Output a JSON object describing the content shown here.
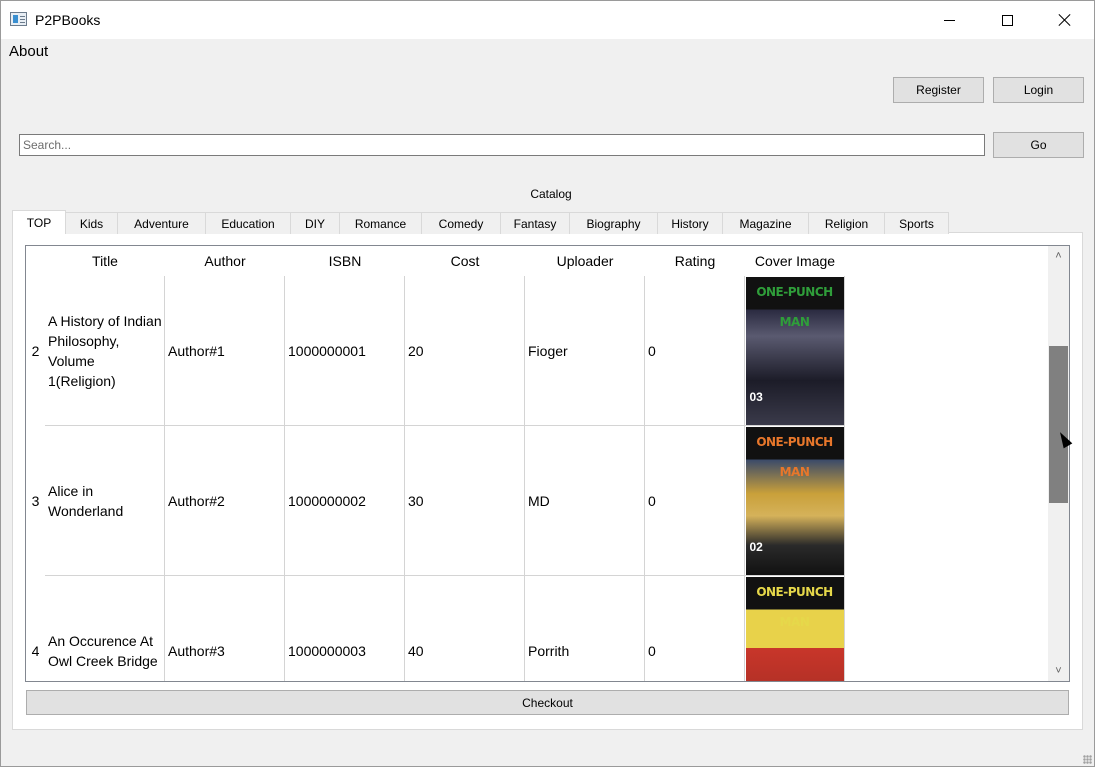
{
  "window": {
    "title": "P2PBooks",
    "icon": "app-window-icon"
  },
  "menu": {
    "about": "About"
  },
  "auth": {
    "register": "Register",
    "login": "Login"
  },
  "search": {
    "placeholder": "Search...",
    "value": "",
    "go": "Go"
  },
  "catalog": {
    "label": "Catalog",
    "tabs": [
      "TOP",
      "Kids",
      "Adventure",
      "Education",
      "DIY",
      "Romance",
      "Comedy",
      "Fantasy",
      "Biography",
      "History",
      "Magazine",
      "Religion",
      "Sports"
    ],
    "active_tab": "TOP"
  },
  "table": {
    "columns": [
      "Title",
      "Author",
      "ISBN",
      "Cost",
      "Uploader",
      "Rating",
      "Cover Image"
    ],
    "rows": [
      {
        "index": "2",
        "title": "A History of Indian Philosophy, Volume 1(Religion)",
        "author": "Author#1",
        "isbn": "1000000001",
        "cost": "20",
        "uploader": "Fioger",
        "rating": "0",
        "cover": {
          "text": "ONE-PUNCH MAN",
          "volume": "03",
          "color": "#2f9e3a"
        }
      },
      {
        "index": "3",
        "title": "Alice in Wonderland",
        "author": "Author#2",
        "isbn": "1000000002",
        "cost": "30",
        "uploader": "MD",
        "rating": "0",
        "cover": {
          "text": "ONE-PUNCH MAN",
          "volume": "02",
          "color": "#e8772b"
        }
      },
      {
        "index": "4",
        "title": "An Occurence At Owl Creek Bridge",
        "author": "Author#3",
        "isbn": "1000000003",
        "cost": "40",
        "uploader": "Porrith",
        "rating": "0",
        "cover": {
          "text": "ONE-PUNCH MAN",
          "volume": "",
          "color": "#e6d84a"
        }
      }
    ]
  },
  "checkout": {
    "label": "Checkout"
  },
  "colors": {
    "window_bg": "#f0f0f0",
    "button_bg": "#e1e1e1",
    "scroll_thumb": "#808080"
  }
}
